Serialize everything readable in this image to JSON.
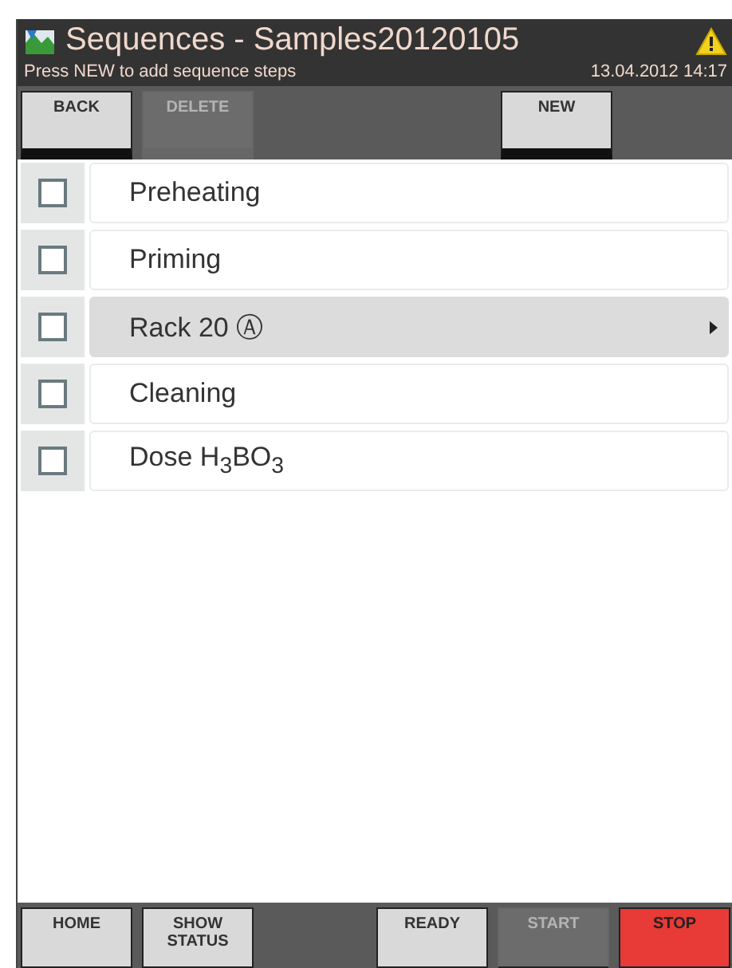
{
  "window": {
    "title": "Sequences - Samples20120105",
    "hint": "Press NEW to add sequence steps",
    "datetime": "13.04.2012 14:17",
    "warning": true
  },
  "toolbar": {
    "left": [
      {
        "label": "BACK",
        "kind": "normal"
      },
      {
        "label": "DELETE",
        "kind": "disabled"
      }
    ],
    "right": [
      {
        "label": "NEW",
        "kind": "normal"
      }
    ]
  },
  "steps": [
    {
      "name": "Preheating",
      "checked": false,
      "selected": false
    },
    {
      "name": "Priming",
      "checked": false,
      "selected": false
    },
    {
      "name": "Rack 20 Ⓐ",
      "checked": false,
      "selected": true
    },
    {
      "name": "Cleaning",
      "checked": false,
      "selected": false
    },
    {
      "name": "Dose H$_{3}$BO$_{3}$",
      "checked": false,
      "selected": false
    }
  ],
  "footer": {
    "left": [
      {
        "label": "HOME",
        "kind": "normal"
      },
      {
        "label": "SHOW STATUS",
        "kind": "normal"
      }
    ],
    "right": [
      {
        "label": "READY",
        "kind": "normal"
      },
      {
        "label": "START",
        "kind": "disabled"
      },
      {
        "label": "STOP",
        "kind": "stop"
      }
    ]
  }
}
